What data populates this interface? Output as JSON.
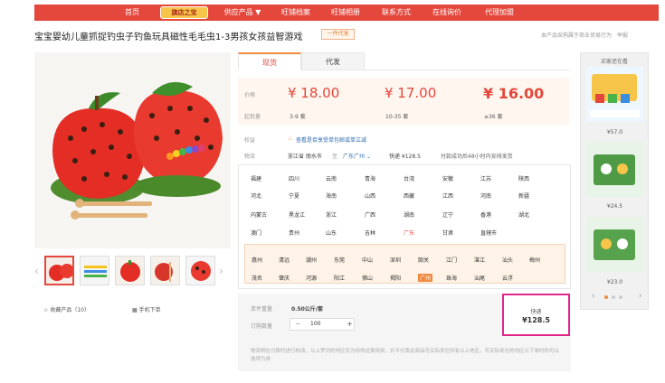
{
  "nav": {
    "items": [
      "首页",
      "旗店之宝",
      "供应产品 ▼",
      "旺铺档案",
      "旺铺相册",
      "联系方式",
      "在线询价",
      "代理加盟"
    ]
  },
  "product": {
    "title": "宝宝婴幼儿童抓捉钓虫子钓鱼玩具磁性毛毛虫1-3男孩女孩益智游戏",
    "badge": "一件代发",
    "right_links": "本产品采购属于商业贸易行为　举报"
  },
  "tabs": [
    "现货",
    "代发"
  ],
  "pricing": {
    "price_label": "价格",
    "qty_label": "起批量",
    "tiers": [
      {
        "price": "¥ 18.00",
        "qty": "3-9 套"
      },
      {
        "price": "¥ 17.00",
        "qty": "10-35 套"
      },
      {
        "price": "¥ 16.00",
        "qty": "≥36 套"
      }
    ]
  },
  "rights": {
    "label": "权益",
    "text": "查看是否享受单包邮或单立减"
  },
  "logistics": {
    "label": "物流",
    "from": "浙江省 丽水市",
    "arrow": "至",
    "to": "广东广州 ⌄",
    "express": "快递 ¥128.5",
    "promise": "付款成功后48小时内安排发货"
  },
  "provinces": [
    [
      "福建",
      "四川",
      "云南",
      "青海",
      "台湾",
      "安徽",
      "江苏",
      "陕西"
    ],
    [
      "河北",
      "宁夏",
      "海南",
      "山西",
      "西藏",
      "江西",
      "河南",
      "新疆"
    ],
    [
      "内蒙古",
      "黑龙江",
      "浙江",
      "广西",
      "湖南",
      "辽宁",
      "香港",
      "湖北"
    ],
    [
      "澳门",
      "贵州",
      "山东",
      "吉林",
      "广东",
      "甘肃",
      "直辖市",
      ""
    ]
  ],
  "selected_province": "广东",
  "cities": [
    [
      "惠州",
      "清远",
      "潮州",
      "东莞",
      "中山",
      "深圳",
      "韶关",
      "江门",
      "湛江",
      "汕头",
      "梅州"
    ],
    [
      "茂名",
      "肇庆",
      "河源",
      "阳江",
      "佛山",
      "揭阳",
      "广州",
      "珠海",
      "汕尾",
      "云浮",
      ""
    ]
  ],
  "selected_city": "广州",
  "order": {
    "weight_label": "单件重量",
    "weight_value": "0.50公斤/套",
    "qty_label": "订购数量",
    "quantity": "100",
    "minus": "−",
    "plus": "+"
  },
  "shipping": {
    "method": "快递",
    "price": "¥128.5"
  },
  "note": "物流明在付款时进行核改，以上罗列的地区仅为特效运费用用，并不代表此商品可买际发往所有以上地区，可买际发往的地区以下单时的可以选项为准",
  "actions": {
    "favorite": "收藏产品（10）",
    "mobile": "手机下单"
  },
  "sidebar": {
    "title": "买家还在看",
    "items": [
      {
        "price": "¥57.0"
      },
      {
        "price": "¥24.5"
      },
      {
        "price": "¥23.0"
      }
    ]
  },
  "colors": {
    "brand": "#e4473c",
    "accent": "#f08a3c",
    "highlight": "#e0288a"
  }
}
